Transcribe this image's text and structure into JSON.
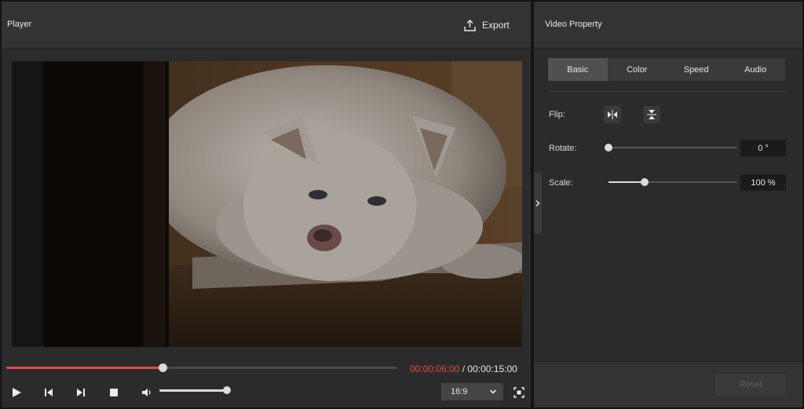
{
  "player": {
    "title": "Player",
    "export_label": "Export",
    "progress_fraction": 0.4,
    "time_current": "00:00:06:00",
    "time_separator": " / ",
    "time_total": "00:00:15:00",
    "volume_fraction": 1.0,
    "aspect_ratio": "16:9",
    "controls": [
      "play-icon",
      "skip-back-icon",
      "skip-forward-icon",
      "stop-icon",
      "volume-icon",
      "fullscreen-icon"
    ]
  },
  "properties": {
    "title": "Video Property",
    "tabs": [
      {
        "label": "Basic",
        "active": true
      },
      {
        "label": "Color",
        "active": false
      },
      {
        "label": "Speed",
        "active": false
      },
      {
        "label": "Audio",
        "active": false
      }
    ],
    "flip": {
      "label": "Flip:"
    },
    "rotate": {
      "label": "Rotate:",
      "value": "0 °",
      "fraction": 0.0
    },
    "scale": {
      "label": "Scale:",
      "value": "100 %",
      "fraction": 0.28
    },
    "reset_label": "Reset"
  },
  "colors": {
    "accent_red": "#e64646",
    "panel_bg": "#2b2b2b",
    "header_bg": "#333333"
  }
}
